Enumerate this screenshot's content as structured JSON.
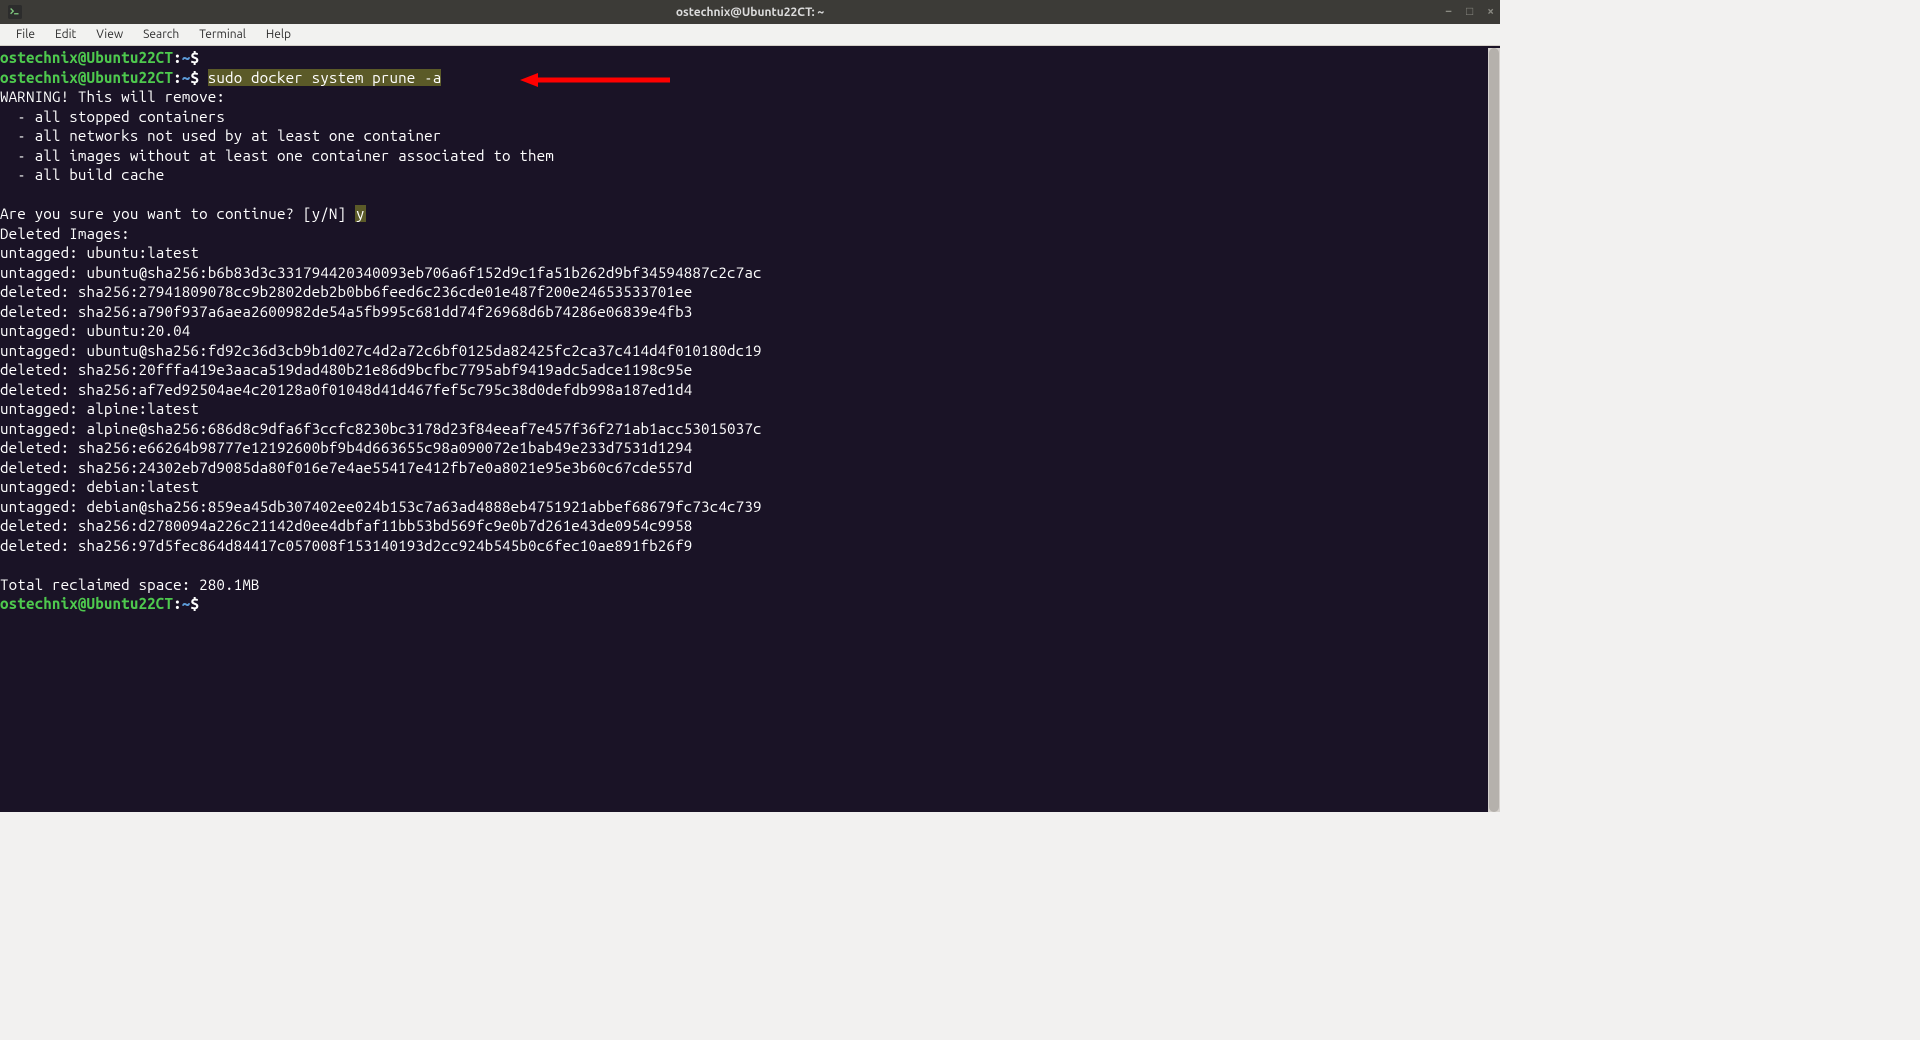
{
  "titlebar": {
    "title": "ostechnix@Ubuntu22CT: ~"
  },
  "menubar": {
    "file": "File",
    "edit": "Edit",
    "view": "View",
    "search": "Search",
    "terminal": "Terminal",
    "help": "Help"
  },
  "prompt": {
    "userhost": "ostechnix@Ubuntu22CT",
    "path": "~",
    "symbol": "$"
  },
  "command": "sudo docker system prune -a",
  "confirm_y": "y",
  "output": {
    "l1": "WARNING! This will remove:",
    "l2": "  - all stopped containers",
    "l3": "  - all networks not used by at least one container",
    "l4": "  - all images without at least one container associated to them",
    "l5": "  - all build cache",
    "l6": "",
    "l7": "Are you sure you want to continue? [y/N] ",
    "l8": "Deleted Images:",
    "l9": "untagged: ubuntu:latest",
    "l10": "untagged: ubuntu@sha256:b6b83d3c331794420340093eb706a6f152d9c1fa51b262d9bf34594887c2c7ac",
    "l11": "deleted: sha256:27941809078cc9b2802deb2b0bb6feed6c236cde01e487f200e24653533701ee",
    "l12": "deleted: sha256:a790f937a6aea2600982de54a5fb995c681dd74f26968d6b74286e06839e4fb3",
    "l13": "untagged: ubuntu:20.04",
    "l14": "untagged: ubuntu@sha256:fd92c36d3cb9b1d027c4d2a72c6bf0125da82425fc2ca37c414d4f010180dc19",
    "l15": "deleted: sha256:20fffa419e3aaca519dad480b21e86d9bcfbc7795abf9419adc5adce1198c95e",
    "l16": "deleted: sha256:af7ed92504ae4c20128a0f01048d41d467fef5c795c38d0defdb998a187ed1d4",
    "l17": "untagged: alpine:latest",
    "l18": "untagged: alpine@sha256:686d8c9dfa6f3ccfc8230bc3178d23f84eeaf7e457f36f271ab1acc53015037c",
    "l19": "deleted: sha256:e66264b98777e12192600bf9b4d663655c98a090072e1bab49e233d7531d1294",
    "l20": "deleted: sha256:24302eb7d9085da80f016e7e4ae55417e412fb7e0a8021e95e3b60c67cde557d",
    "l21": "untagged: debian:latest",
    "l22": "untagged: debian@sha256:859ea45db307402ee024b153c7a63ad4888eb4751921abbef68679fc73c4c739",
    "l23": "deleted: sha256:d2780094a226c21142d0ee4dbfaf11bb53bd569fc9e0b7d261e43de0954c9958",
    "l24": "deleted: sha256:97d5fec864d84417c057008f153140193d2cc924b545b0c6fec10ae891fb26f9",
    "l25": "",
    "l26": "Total reclaimed space: 280.1MB"
  }
}
